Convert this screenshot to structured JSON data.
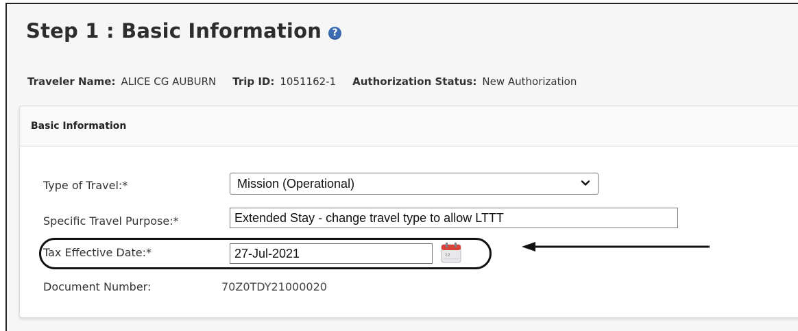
{
  "page": {
    "title": "Step 1 : Basic Information",
    "help_icon_glyph": "?"
  },
  "traveler_info": {
    "traveler_name_label": "Traveler Name:",
    "traveler_name": "ALICE CG AUBURN",
    "trip_id_label": "Trip ID:",
    "trip_id": "1051162-1",
    "authorization_status_label": "Authorization Status:",
    "authorization_status": "New Authorization"
  },
  "panel": {
    "header": "Basic Information",
    "type_of_travel_label": "Type of Travel:*",
    "type_of_travel_value": "Mission (Operational)",
    "specific_purpose_label": "Specific Travel Purpose:*",
    "specific_purpose_value": "Extended Stay - change travel type to allow LTTT",
    "tax_effective_date_label": "Tax Effective Date:*",
    "tax_effective_date_value": "27-Jul-2021",
    "document_number_label": "Document Number:",
    "document_number_value": "70Z0TDY21000020"
  },
  "colors": {
    "accent_help": "#3b6cb3",
    "calendar_red": "#d9423a",
    "annotation": "#111111"
  },
  "icons": {
    "help": "question-circle-icon",
    "dropdown": "chevron-down-icon",
    "calendar": "calendar-icon",
    "annotation_arrow": "arrow-left-icon"
  }
}
